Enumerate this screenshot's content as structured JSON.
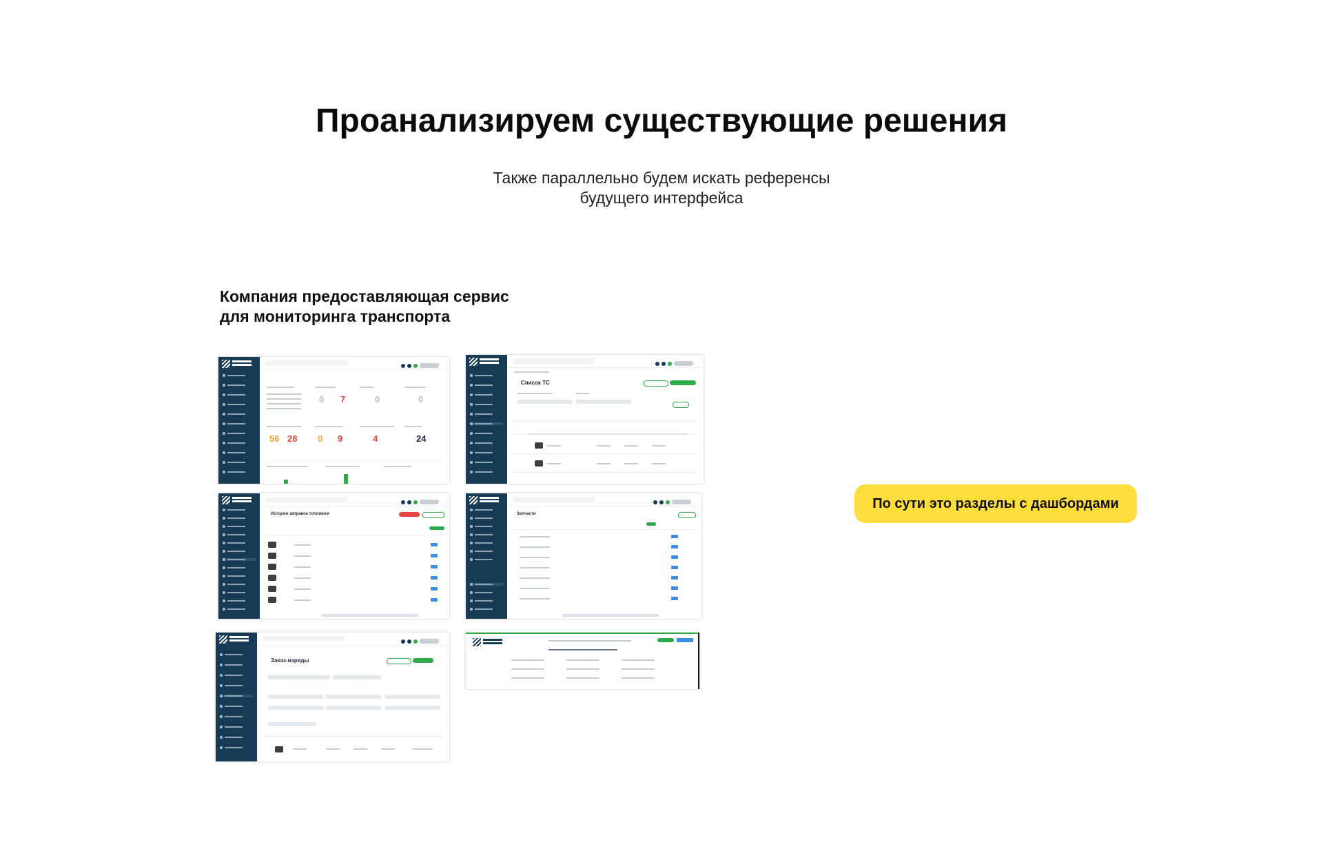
{
  "title": "Проанализируем существующие решения",
  "subtitle": {
    "line1": "Также параллельно будем искать референсы",
    "line2": "будущего интерфейса"
  },
  "section": {
    "line1": "Компания предоставляющая сервис",
    "line2": "для мониторинга транспорта"
  },
  "callout": "По сути это разделы с дашбордами",
  "colors": {
    "callout_bg": "#fdde3c",
    "sidebar": "#173a55",
    "accent_green": "#2eaa4a"
  },
  "thumbnails": {
    "list": {
      "title": "Список ТС"
    },
    "fuel": {
      "title": "История заправок топливом"
    },
    "parts": {
      "title": "Запчасти"
    },
    "orders": {
      "title": "Заказ-наряды"
    },
    "dashboard": {
      "metrics": [
        "0",
        "7",
        "0",
        "0",
        "56",
        "28",
        "0",
        "9",
        "4",
        "24"
      ]
    }
  }
}
